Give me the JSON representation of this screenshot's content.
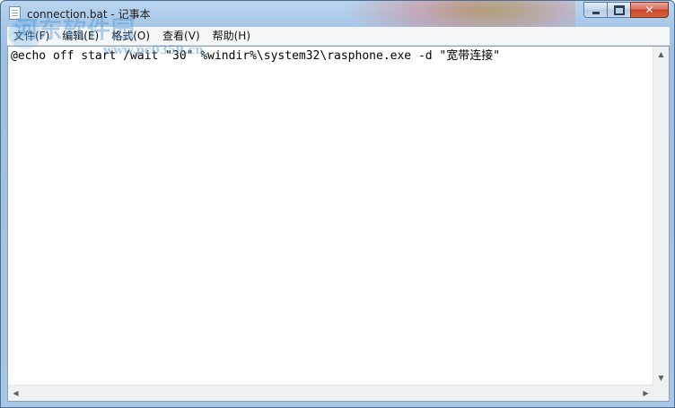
{
  "window": {
    "title": "connection.bat - 记事本"
  },
  "menu": {
    "items": [
      {
        "label": "文件(F)"
      },
      {
        "label": "编辑(E)"
      },
      {
        "label": "格式(O)"
      },
      {
        "label": "查看(V)"
      },
      {
        "label": "帮助(H)"
      }
    ]
  },
  "editor": {
    "text": "@echo off start /wait \"30\" %windir%\\system32\\rasphone.exe -d \"宽带连接\""
  },
  "watermark": {
    "text": "河东软件园",
    "url": "www.pc0359.cn"
  },
  "colors": {
    "frame": "#a7c7e7",
    "close_button": "#c5432d",
    "editor_background": "#ffffff"
  },
  "icons": {
    "app": "notepad-icon",
    "minimize": "minimize-icon",
    "maximize": "maximize-icon",
    "close": "close-icon"
  }
}
